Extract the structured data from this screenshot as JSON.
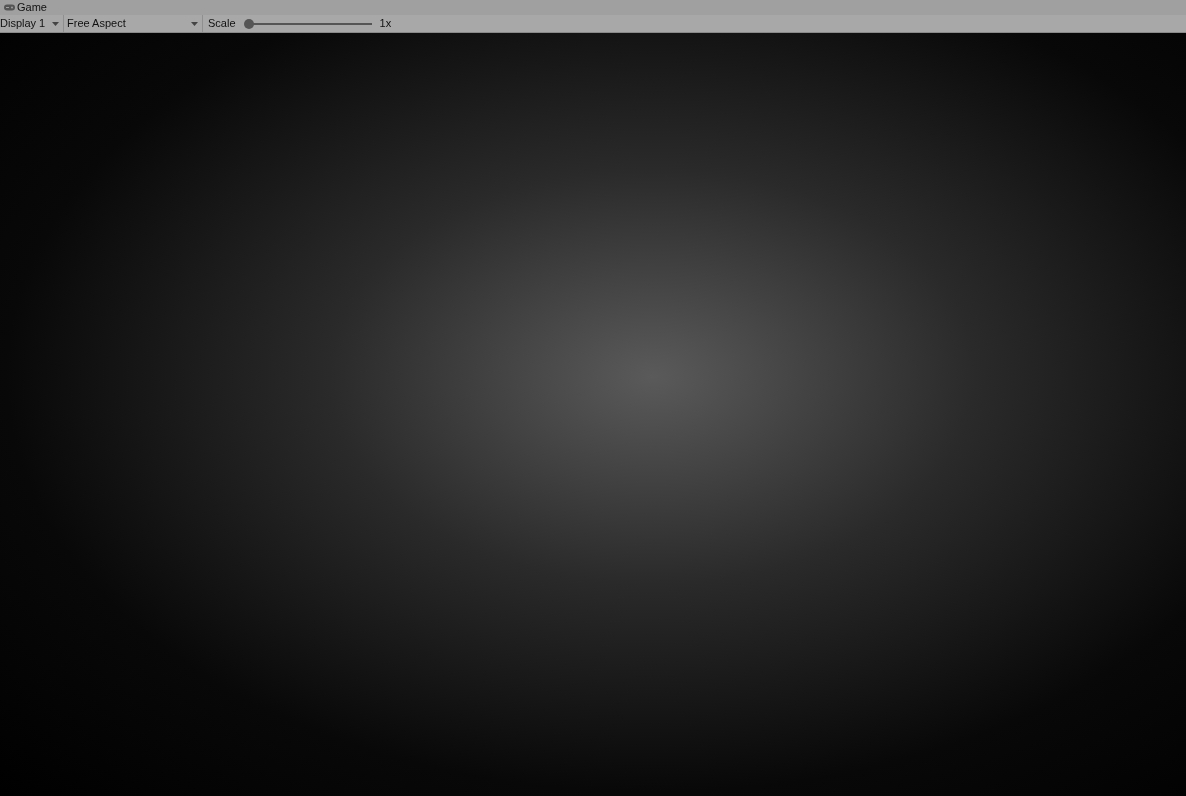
{
  "window": {
    "tab": "Game"
  },
  "toolbar": {
    "display": "Display 1",
    "aspect": "Free Aspect",
    "scale": {
      "label": "Scale",
      "level": 0,
      "reading": "1x"
    }
  }
}
